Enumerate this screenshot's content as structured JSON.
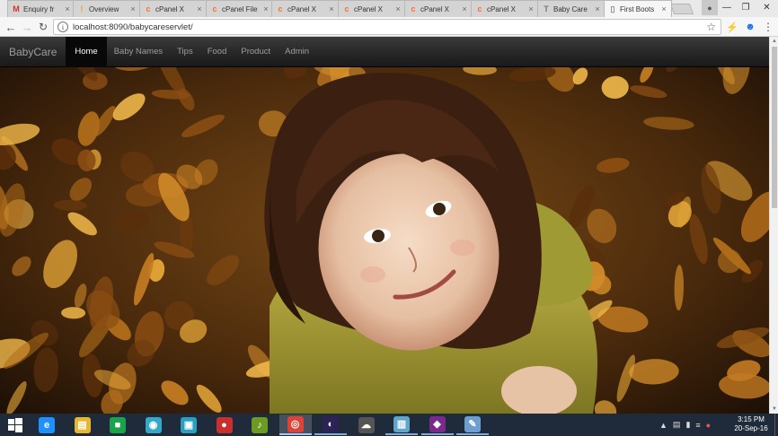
{
  "browser": {
    "tabs": [
      {
        "title": "Enquiry fr",
        "icon": "gmail-icon",
        "glyph": "M",
        "color": "#d93025"
      },
      {
        "title": "Overview",
        "icon": "warning-icon",
        "glyph": "!",
        "color": "#f0a30a"
      },
      {
        "title": "cPanel X",
        "icon": "cpanel-icon",
        "glyph": "c",
        "color": "#ff6c2c"
      },
      {
        "title": "cPanel File",
        "icon": "cpanel-icon",
        "glyph": "c",
        "color": "#ff6c2c"
      },
      {
        "title": "cPanel X",
        "icon": "cpanel-icon",
        "glyph": "c",
        "color": "#ff6c2c"
      },
      {
        "title": "cPanel X",
        "icon": "cpanel-icon",
        "glyph": "c",
        "color": "#ff6c2c"
      },
      {
        "title": "cPanel X",
        "icon": "cpanel-icon",
        "glyph": "c",
        "color": "#ff6c2c"
      },
      {
        "title": "cPanel X",
        "icon": "cpanel-icon",
        "glyph": "c",
        "color": "#ff6c2c"
      },
      {
        "title": "Baby Care",
        "icon": "text-icon",
        "glyph": "T",
        "color": "#777777"
      },
      {
        "title": "First Boots",
        "icon": "page-icon",
        "glyph": "▯",
        "color": "#888888"
      }
    ],
    "active_tab": 9,
    "url": "localhost:8090/babycareservlet/"
  },
  "site": {
    "brand": "BabyCare",
    "nav": [
      "Home",
      "Baby Names",
      "Tips",
      "Food",
      "Product",
      "Admin"
    ],
    "active_nav": 0
  },
  "hero": {
    "subject": "smiling-girl-in-autumn-leaves"
  },
  "taskbar": {
    "apps": [
      {
        "name": "internet-explorer-icon",
        "glyph": "e",
        "color": "#1e90ff",
        "state": ""
      },
      {
        "name": "file-explorer-icon",
        "glyph": "▤",
        "color": "#e8b730",
        "state": ""
      },
      {
        "name": "store-icon",
        "glyph": "■",
        "color": "#1aa34a",
        "state": ""
      },
      {
        "name": "media-icon",
        "glyph": "◉",
        "color": "#35a7c7",
        "state": ""
      },
      {
        "name": "screen-icon",
        "glyph": "▣",
        "color": "#2aa0c0",
        "state": ""
      },
      {
        "name": "record-icon",
        "glyph": "●",
        "color": "#c9302c",
        "state": ""
      },
      {
        "name": "music-player-icon",
        "glyph": "♪",
        "color": "#6b9b23",
        "state": ""
      },
      {
        "name": "chrome-icon",
        "glyph": "◎",
        "color": "#db4437",
        "state": "active"
      },
      {
        "name": "eclipse-icon",
        "glyph": "◐",
        "color": "#2c2255",
        "state": "open"
      },
      {
        "name": "server-icon",
        "glyph": "☁",
        "color": "#555555",
        "state": ""
      },
      {
        "name": "notebook-icon",
        "glyph": "▥",
        "color": "#5fa6c9",
        "state": "open"
      },
      {
        "name": "game-icon",
        "glyph": "◆",
        "color": "#7a2a8a",
        "state": "open"
      },
      {
        "name": "paint-icon",
        "glyph": "✎",
        "color": "#6e9ecf",
        "state": "open"
      }
    ],
    "time": "3:15 PM",
    "date": "20-Sep-16"
  }
}
